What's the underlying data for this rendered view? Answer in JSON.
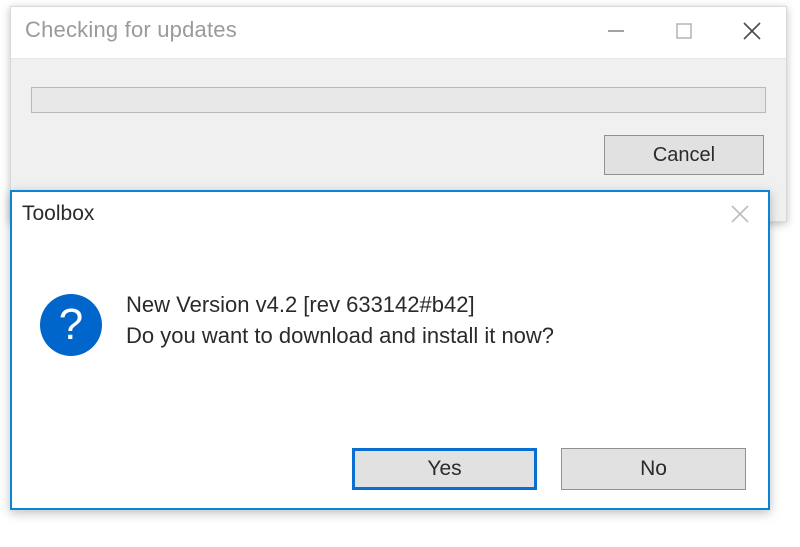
{
  "backDialog": {
    "title": "Checking for updates",
    "cancel_label": "Cancel"
  },
  "frontDialog": {
    "title": "Toolbox",
    "message_line1": "New Version v4.2 [rev 633142#b42]",
    "message_line2": "Do you want to download and install it now?",
    "yes_label": "Yes",
    "no_label": "No"
  }
}
